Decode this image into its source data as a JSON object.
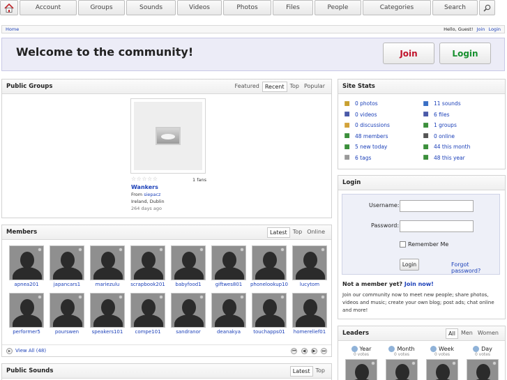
{
  "nav": {
    "items": [
      "Account",
      "Groups",
      "Sounds",
      "Videos",
      "Photos",
      "Files",
      "People",
      "Categories",
      "Search"
    ]
  },
  "breadcrumb": {
    "home": "Home",
    "greeting": "Hello, Guest!",
    "join": "Join",
    "login": "Login"
  },
  "welcome": {
    "title": "Welcome to the community!",
    "join_label": "Join",
    "login_label": "Login"
  },
  "public_groups": {
    "title": "Public Groups",
    "tabs": [
      "Featured",
      "Recent",
      "Top",
      "Popular"
    ],
    "active_tab": "Recent",
    "group": {
      "stars": "☆☆☆☆☆",
      "fans": "1 fans",
      "name": "Wankers",
      "from_label": "From",
      "owner": "siepacz",
      "location": "Ireland, Dublin",
      "age": "264 days ago"
    }
  },
  "members": {
    "title": "Members",
    "tabs": [
      "Latest",
      "Top",
      "Online"
    ],
    "active_tab": "Latest",
    "list": [
      "apnea201",
      "japancars1",
      "mariezulu",
      "scrapbook201",
      "babyfood1",
      "giftwes801",
      "phonelookup10",
      "lucytom",
      "performer5",
      "pourswen",
      "speakers101",
      "compe101",
      "sandranor",
      "deanakya",
      "touchapps01",
      "homerelief01"
    ],
    "view_all": "View All (48)",
    "pager": [
      "⏮",
      "◀",
      "▶",
      "⏭"
    ]
  },
  "public_sounds": {
    "title": "Public Sounds",
    "tabs": [
      "Latest",
      "Top"
    ],
    "active_tab": "Latest"
  },
  "site_stats": {
    "title": "Site Stats",
    "left": [
      {
        "icon": "photo-icon",
        "label": "0 photos",
        "color": "#c8a030"
      },
      {
        "icon": "video-icon",
        "label": "0 videos",
        "color": "#4a5aa8"
      },
      {
        "icon": "discussion-icon",
        "label": "0 discussions",
        "color": "#d2a23a"
      },
      {
        "icon": "members-icon",
        "label": "48 members",
        "color": "#3b8f3b"
      },
      {
        "icon": "new-today-icon",
        "label": "5 new today",
        "color": "#3b8f3b"
      },
      {
        "icon": "tag-icon",
        "label": "6 tags",
        "color": "#999999"
      }
    ],
    "right": [
      {
        "icon": "sound-icon",
        "label": "11 sounds",
        "color": "#3a6fc4"
      },
      {
        "icon": "file-icon",
        "label": "6 files",
        "color": "#4a5aa8"
      },
      {
        "icon": "groups-icon",
        "label": "1 groups",
        "color": "#3b8f3b"
      },
      {
        "icon": "online-icon",
        "label": "0 online",
        "color": "#555555"
      },
      {
        "icon": "month-icon",
        "label": "44 this month",
        "color": "#3b8f3b"
      },
      {
        "icon": "year-icon",
        "label": "48 this year",
        "color": "#3b8f3b"
      }
    ]
  },
  "login": {
    "title": "Login",
    "username_label": "Username:",
    "password_label": "Password:",
    "remember_label": "Remember Me",
    "button_label": "Login",
    "forgot_label": "Forgot password?",
    "not_member": "Not a member yet?",
    "join_now": "Join now!",
    "blurb": "Join our community now to meet new people; share photos, videos and music; create your own blog; post ads; chat online and more!"
  },
  "leaders": {
    "title": "Leaders",
    "tabs": [
      "All",
      "Men",
      "Women"
    ],
    "active_tab": "All",
    "cols": [
      {
        "label": "Year",
        "votes": "0 votes"
      },
      {
        "label": "Month",
        "votes": "0 votes"
      },
      {
        "label": "Week",
        "votes": "0 votes"
      },
      {
        "label": "Day",
        "votes": "0 votes"
      }
    ]
  }
}
